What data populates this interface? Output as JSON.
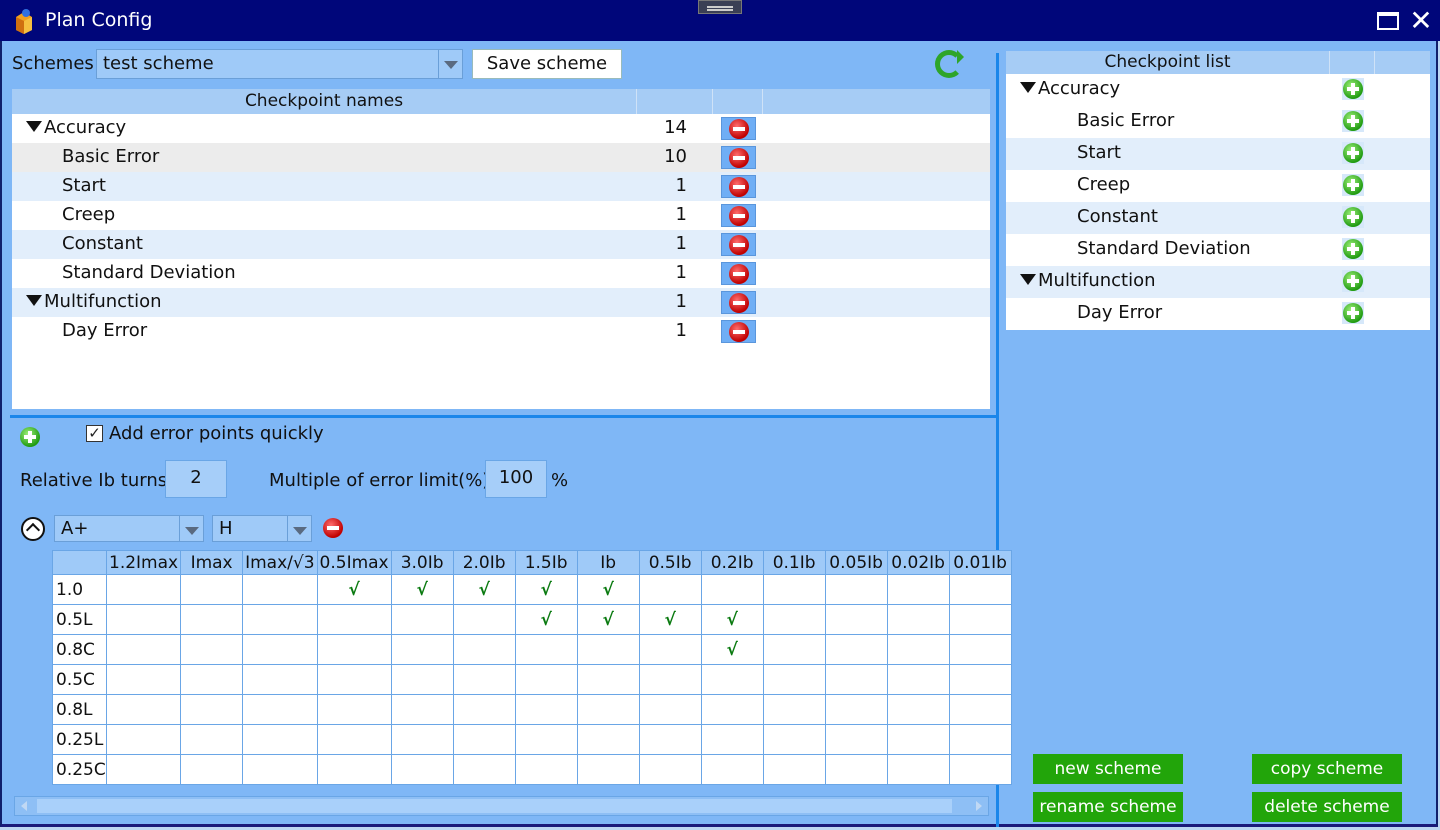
{
  "window": {
    "title": "Plan Config"
  },
  "scheme_bar": {
    "label": "Schemes",
    "selected": "test scheme",
    "save_label": "Save scheme"
  },
  "names_panel": {
    "header": "Checkpoint names",
    "rows": [
      {
        "name": "Accuracy",
        "count": "14"
      },
      {
        "name": "Basic Error",
        "count": "10"
      },
      {
        "name": "Start",
        "count": "1"
      },
      {
        "name": "Creep",
        "count": "1"
      },
      {
        "name": "Constant",
        "count": "1"
      },
      {
        "name": "Standard Deviation",
        "count": "1"
      },
      {
        "name": "Multifunction",
        "count": "1"
      },
      {
        "name": "Day Error",
        "count": "1"
      }
    ]
  },
  "error_points": {
    "quick_add_label": "Add error points quickly",
    "quick_add_checked": true,
    "turns_label": "Relative Ib turns:",
    "turns_value": "2",
    "multiple_label": "Multiple of error limit(%):",
    "multiple_value": "100",
    "percent": "%",
    "phase_selected": "A+",
    "harmonic_selected": "H"
  },
  "grid": {
    "columns": [
      "1.2Imax",
      "Imax",
      "Imax/√3",
      "0.5Imax",
      "3.0Ib",
      "2.0Ib",
      "1.5Ib",
      "Ib",
      "0.5Ib",
      "0.2Ib",
      "0.1Ib",
      "0.05Ib",
      "0.02Ib",
      "0.01Ib"
    ],
    "rows": [
      {
        "label": "1.0",
        "cells": [
          "",
          "",
          "",
          "√",
          "√",
          "√",
          "√",
          "√",
          "",
          "",
          "",
          "",
          "",
          ""
        ]
      },
      {
        "label": "0.5L",
        "cells": [
          "",
          "",
          "",
          "",
          "",
          "",
          "√",
          "√",
          "√",
          "√",
          "",
          "",
          "",
          ""
        ]
      },
      {
        "label": "0.8C",
        "cells": [
          "",
          "",
          "",
          "",
          "",
          "",
          "",
          "",
          "",
          "√",
          "",
          "",
          "",
          ""
        ]
      },
      {
        "label": "0.5C",
        "cells": [
          "",
          "",
          "",
          "",
          "",
          "",
          "",
          "",
          "",
          "",
          "",
          "",
          "",
          ""
        ]
      },
      {
        "label": "0.8L",
        "cells": [
          "",
          "",
          "",
          "",
          "",
          "",
          "",
          "",
          "",
          "",
          "",
          "",
          "",
          ""
        ]
      },
      {
        "label": "0.25L",
        "cells": [
          "",
          "",
          "",
          "",
          "",
          "",
          "",
          "",
          "",
          "",
          "",
          "",
          "",
          ""
        ]
      },
      {
        "label": "0.25C",
        "cells": [
          "",
          "",
          "",
          "",
          "",
          "",
          "",
          "",
          "",
          "",
          "",
          "",
          "",
          ""
        ]
      }
    ]
  },
  "checkpoint_list": {
    "header": "Checkpoint list",
    "rows": [
      {
        "name": "Accuracy"
      },
      {
        "name": "Basic Error"
      },
      {
        "name": "Start"
      },
      {
        "name": "Creep"
      },
      {
        "name": "Constant"
      },
      {
        "name": "Standard Deviation"
      },
      {
        "name": "Multifunction"
      },
      {
        "name": "Day Error"
      }
    ]
  },
  "actions": {
    "new_label": "new scheme",
    "copy_label": "copy scheme",
    "rename_label": "rename scheme",
    "delete_label": "delete scheme"
  }
}
